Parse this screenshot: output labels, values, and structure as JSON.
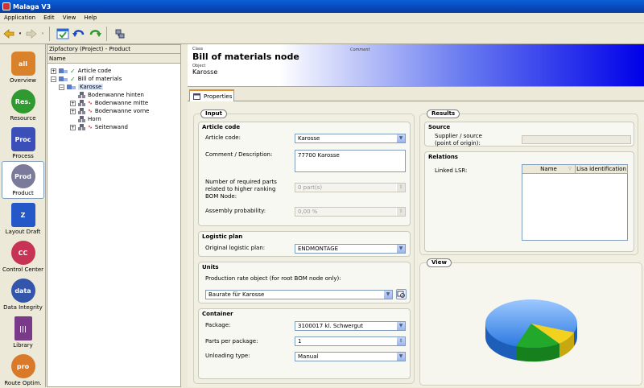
{
  "window": {
    "title": "Malaga V3"
  },
  "menu": [
    "Application",
    "Edit",
    "View",
    "Help"
  ],
  "toolbar": {
    "icons": [
      "back-arrow-icon",
      "forward-arrow-icon",
      "check-window-icon",
      "undo-icon",
      "redo-icon",
      "network-icon"
    ]
  },
  "nav": {
    "items": [
      {
        "label": "Overview",
        "icon": "overview-icon",
        "color": "#d9822b"
      },
      {
        "label": "Resource",
        "icon": "resource-icon",
        "color": "#2f9a2f"
      },
      {
        "label": "Process",
        "icon": "process-icon",
        "color": "#3a4fb8"
      },
      {
        "label": "Product",
        "icon": "product-icon",
        "color": "#7a7a9a"
      },
      {
        "label": "Layout Draft",
        "icon": "layout-draft-icon",
        "color": "#2457c8"
      },
      {
        "label": "Control Center",
        "icon": "control-center-icon",
        "color": "#c63355"
      },
      {
        "label": "Data Integrity",
        "icon": "data-integrity-icon",
        "color": "#3355aa"
      },
      {
        "label": "Library",
        "icon": "library-icon",
        "color": "#7a3a8a"
      },
      {
        "label": "Route Optim.",
        "icon": "route-optim-icon",
        "color": "#d87a2a"
      }
    ],
    "selected": "Product"
  },
  "tree": {
    "header": "Zipfactory (Project) - Product",
    "column": "Name",
    "rows": [
      {
        "label": "Article code",
        "level": 0
      },
      {
        "label": "Bill of materials",
        "level": 0
      },
      {
        "label": "Karosse",
        "level": 1
      },
      {
        "label": "Bodenwanne hinten",
        "level": 2
      },
      {
        "label": "Bodenwanne mitte",
        "level": 2
      },
      {
        "label": "Bodenwanne vorne",
        "level": 2
      },
      {
        "label": "Horn",
        "level": 2
      },
      {
        "label": "Seitenwand",
        "level": 2
      }
    ]
  },
  "header": {
    "class_label": "Class",
    "title": "Bill of materials node",
    "comment_label": "Comment",
    "object_label": "Object",
    "object_value": "Karosse"
  },
  "tabs": {
    "properties": "Properties"
  },
  "input": {
    "title": "Input",
    "article_code": {
      "title": "Article code",
      "article_label": "Article code:",
      "article_value": "Karosse",
      "comment_label": "Comment / Description:",
      "comment_value": "77700 Karosse",
      "parts_label": "Number of required parts related to higher ranking BOM Node:",
      "parts_value": "0 part(s)",
      "prob_label": "Assembly probability:",
      "prob_value": "0,00 %"
    },
    "logistic": {
      "title": "Logistic plan",
      "label": "Original logistic plan:",
      "value": "ENDMONTAGE"
    },
    "units": {
      "title": "Units",
      "label": "Production rate object (for root BOM node only):",
      "value": "Baurate für Karosse"
    },
    "container": {
      "title": "Container",
      "package_label": "Package:",
      "package_value": "3100017 kl. Schwergut",
      "ppp_label": "Parts per package:",
      "ppp_value": "1",
      "unload_label": "Unloading type:",
      "unload_value": "Manual"
    }
  },
  "results": {
    "title": "Results",
    "source": {
      "title": "Source",
      "label": "Supplier / source (point of origin):"
    },
    "relations": {
      "title": "Relations",
      "label": "Linked LSR:",
      "col_name": "Name",
      "col_lisa": "Lisa identification"
    }
  },
  "view": {
    "title": "View"
  },
  "pie_colors": {
    "blue": "#3b8ee8",
    "green": "#22a82a",
    "yellow": "#f2d21e"
  }
}
